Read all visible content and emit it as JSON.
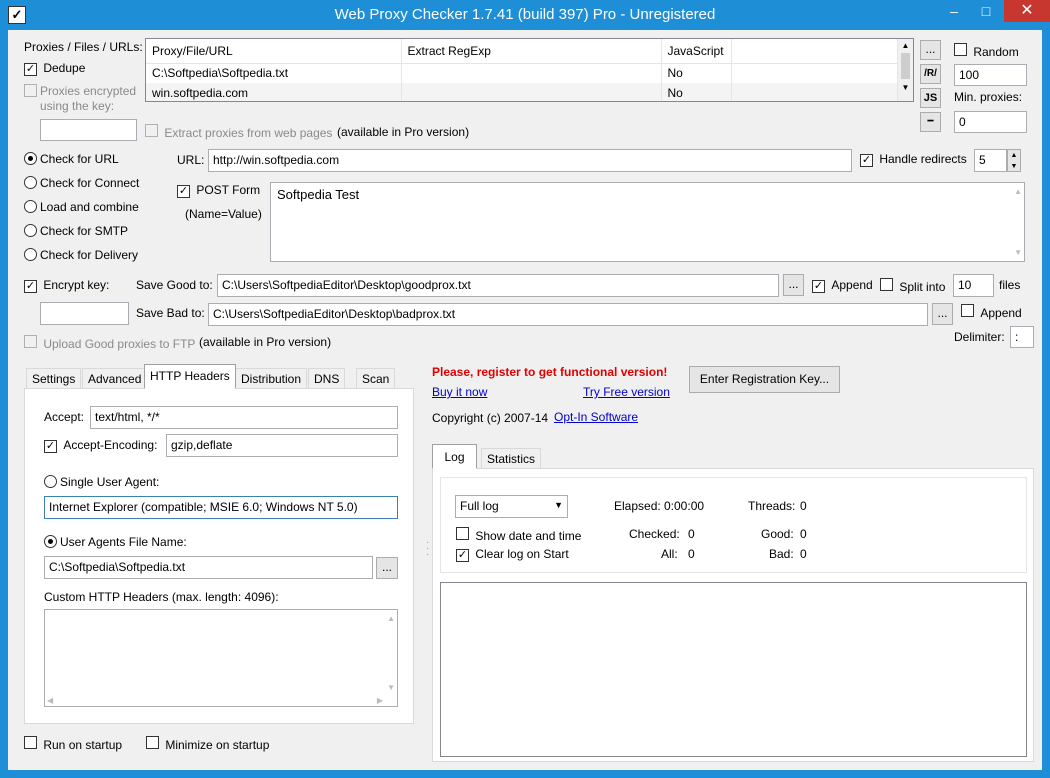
{
  "window": {
    "title": "Web Proxy Checker 1.7.41 (build 397) Pro - Unregistered",
    "minimize": "–",
    "maximize": "□",
    "close": "✕"
  },
  "proxies": {
    "label": "Proxies / Files / URLs:",
    "dedupe_label": "Dedupe",
    "encrypted_label_1": "Proxies encrypted",
    "encrypted_label_2": "using the key:",
    "extract_label": "Extract proxies from web pages",
    "pro_note": "(available in Pro version)",
    "columns": [
      "Proxy/File/URL",
      "Extract RegExp",
      "JavaScript"
    ],
    "rows": [
      [
        "C:\\Softpedia\\Softpedia.txt",
        "",
        "No"
      ],
      [
        "win.softpedia.com",
        "",
        "No"
      ]
    ],
    "side_buttons": [
      "...",
      "/R/",
      "JS",
      "━"
    ],
    "random_label": "Random",
    "random_value": "100",
    "min_proxies_label": "Min. proxies:",
    "min_proxies_value": "0"
  },
  "modes": [
    "Check for URL",
    "Check for Connect",
    "Load and combine",
    "Check for SMTP",
    "Check for Delivery"
  ],
  "url": {
    "label": "URL:",
    "value": "http://win.softpedia.com",
    "handle_redirects": "Handle redirects",
    "redirects_value": "5"
  },
  "post": {
    "label": "POST Form",
    "sub": "(Name=Value)",
    "value": "Softpedia Test"
  },
  "save": {
    "encrypt_label": "Encrypt key:",
    "good_label": "Save Good to:",
    "good_value": "C:\\Users\\SoftpediaEditor\\Desktop\\goodprox.txt",
    "bad_label": "Save Bad to:",
    "bad_value": "C:\\Users\\SoftpediaEditor\\Desktop\\badprox.txt",
    "browse": "...",
    "append": "Append",
    "split_label": "Split into",
    "split_value": "10",
    "files": "files",
    "delimiter_label": "Delimiter:",
    "delimiter_value": ":",
    "upload_label": "Upload Good proxies to FTP",
    "pro_note": "(available in Pro version)"
  },
  "tabs": [
    "Settings",
    "Advanced",
    "HTTP Headers",
    "Distribution",
    "DNS",
    "Scan"
  ],
  "headers": {
    "accept_label": "Accept:",
    "accept_value": "text/html, */*",
    "encoding_label": "Accept-Encoding:",
    "encoding_value": "gzip,deflate",
    "single_ua_label": "Single User Agent:",
    "single_ua_value": "Internet Explorer (compatible; MSIE 6.0; Windows NT 5.0)",
    "ua_file_label": "User Agents File Name:",
    "ua_file_value": "C:\\Softpedia\\Softpedia.txt",
    "browse": "...",
    "custom_label": "Custom HTTP Headers (max. length: 4096):"
  },
  "register": {
    "notice": "Please, register to get functional version!",
    "buy": "Buy it now",
    "trial": "Try Free version",
    "enter_key": "Enter Registration Key...",
    "copyright": "Copyright (c) 2007-14",
    "company": "Opt-In Software"
  },
  "log": {
    "tabs": [
      "Log",
      "Statistics"
    ],
    "mode": "Full log",
    "show_date": "Show date and time",
    "clear_on_start": "Clear log on Start",
    "elapsed_label": "Elapsed:",
    "elapsed_value": "0:00:00",
    "threads_label": "Threads:",
    "threads_value": "0",
    "checked_label": "Checked:",
    "checked_value": "0",
    "good_label": "Good:",
    "good_value": "0",
    "all_label": "All:",
    "all_value": "0",
    "bad_label": "Bad:",
    "bad_value": "0"
  },
  "footer": {
    "run_startup": "Run on startup",
    "minimize_startup": "Minimize on startup"
  }
}
